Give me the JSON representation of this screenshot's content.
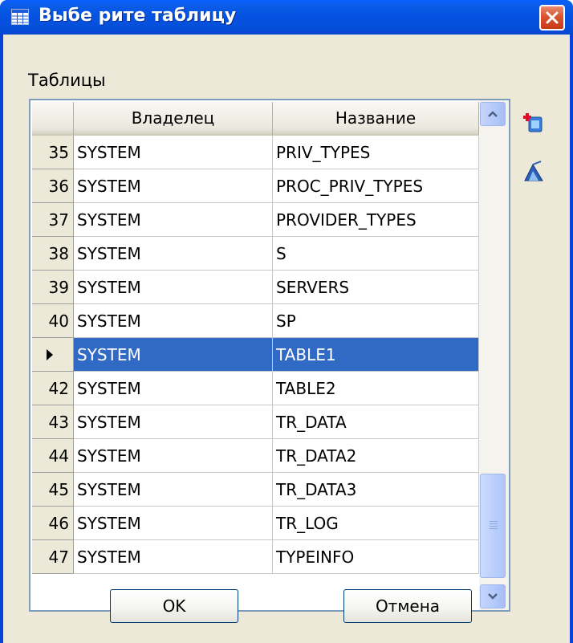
{
  "window": {
    "title": "Выбе рите таблицу",
    "icon": "table-icon",
    "close_icon": "close-icon"
  },
  "group_label": "Таблицы",
  "grid": {
    "columns": [
      "Владелец",
      "Название"
    ],
    "rows": [
      {
        "num": "35",
        "owner": "SYSTEM",
        "name": "PRIV_TYPES",
        "selected": false
      },
      {
        "num": "36",
        "owner": "SYSTEM",
        "name": "PROC_PRIV_TYPES",
        "selected": false
      },
      {
        "num": "37",
        "owner": "SYSTEM",
        "name": "PROVIDER_TYPES",
        "selected": false
      },
      {
        "num": "38",
        "owner": "SYSTEM",
        "name": "S",
        "selected": false
      },
      {
        "num": "39",
        "owner": "SYSTEM",
        "name": "SERVERS",
        "selected": false
      },
      {
        "num": "40",
        "owner": "SYSTEM",
        "name": "SP",
        "selected": false
      },
      {
        "num": "",
        "owner": "SYSTEM",
        "name": "TABLE1",
        "selected": true
      },
      {
        "num": "42",
        "owner": "SYSTEM",
        "name": "TABLE2",
        "selected": false
      },
      {
        "num": "43",
        "owner": "SYSTEM",
        "name": "TR_DATA",
        "selected": false
      },
      {
        "num": "44",
        "owner": "SYSTEM",
        "name": "TR_DATA2",
        "selected": false
      },
      {
        "num": "45",
        "owner": "SYSTEM",
        "name": "TR_DATA3",
        "selected": false
      },
      {
        "num": "46",
        "owner": "SYSTEM",
        "name": "TR_LOG",
        "selected": false
      },
      {
        "num": "47",
        "owner": "SYSTEM",
        "name": "TYPEINFO",
        "selected": false
      }
    ],
    "scroll_position": 0.9
  },
  "side_buttons": [
    {
      "icon": "add-table-icon"
    },
    {
      "icon": "clear-icon"
    }
  ],
  "buttons": {
    "ok_label": "OK",
    "cancel_label": "Отмена"
  },
  "colors": {
    "selection": "#316ac5",
    "title_bar": "#0553e1",
    "window_bg": "#ece9d8"
  }
}
